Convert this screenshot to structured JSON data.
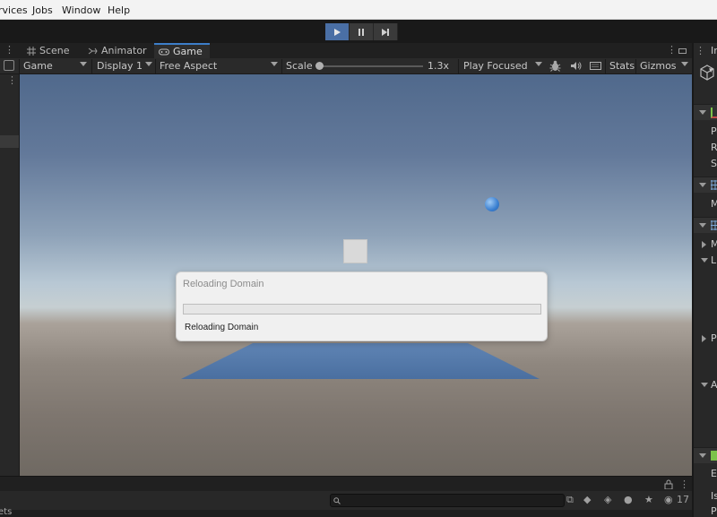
{
  "menu": {
    "items": [
      "rvices",
      "Jobs",
      "Window",
      "Help"
    ]
  },
  "toolbar": {
    "play_active": true
  },
  "tabs": [
    {
      "label": "Scene",
      "icon": "grid-icon"
    },
    {
      "label": "Animator",
      "icon": "animator-icon"
    },
    {
      "label": "Game",
      "icon": "gamepad-icon"
    }
  ],
  "game_toolbar": {
    "view_select": "Game",
    "display_select": "Display 1",
    "aspect_select": "Free Aspect",
    "scale_label": "Scale",
    "scale_value": "1.3x",
    "play_mode_select": "Play Focused",
    "stats_label": "Stats",
    "gizmos_label": "Gizmos"
  },
  "dialog": {
    "title": "Reloading Domain",
    "message": "Reloading Domain",
    "progress": 0
  },
  "inspector": {
    "tab_label": "Ir",
    "labels": [
      "Po",
      "Ro",
      "Sc",
      "M",
      "M",
      "Li",
      "Pr",
      "Ac",
      "Ec",
      "Is",
      "Pr"
    ]
  },
  "console": {
    "badge_count": "17",
    "bottom_label": "ets"
  },
  "colors": {
    "accent": "#3d7ec9",
    "play_active": "#4a6fa5",
    "progress_fill": "#2b7de0"
  }
}
